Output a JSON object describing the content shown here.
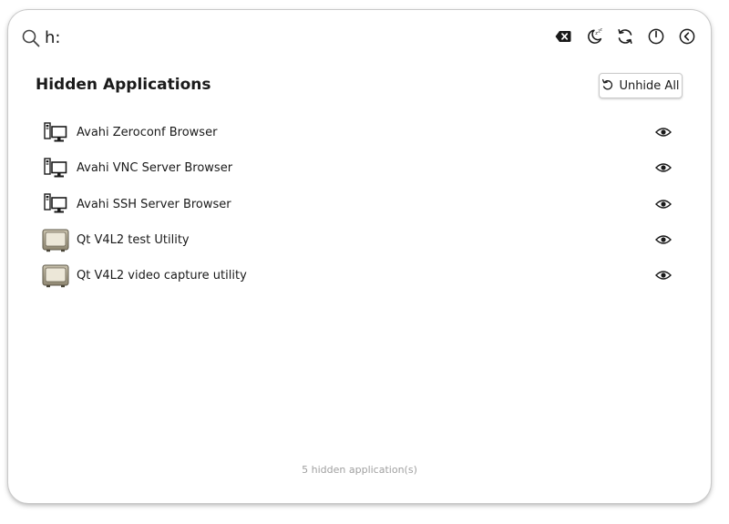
{
  "search": {
    "value": "h:",
    "icon": "search-icon"
  },
  "toolbar": {
    "buttons": [
      {
        "name": "clear-search",
        "icon": "backspace-icon"
      },
      {
        "name": "sleep",
        "icon": "sleep-moon-icon"
      },
      {
        "name": "refresh",
        "icon": "refresh-icon"
      },
      {
        "name": "power",
        "icon": "power-icon"
      },
      {
        "name": "back",
        "icon": "back-arrow-icon"
      }
    ]
  },
  "section": {
    "title": "Hidden Applications"
  },
  "unhide_all": {
    "label": "Unhide All",
    "icon": "undo-icon"
  },
  "apps": [
    {
      "name": "Avahi Zeroconf Browser",
      "icon": "network-computer-icon"
    },
    {
      "name": "Avahi VNC Server Browser",
      "icon": "network-computer-icon"
    },
    {
      "name": "Avahi SSH Server Browser",
      "icon": "network-computer-icon"
    },
    {
      "name": "Qt V4L2 test Utility",
      "icon": "tv-monitor-icon"
    },
    {
      "name": "Qt V4L2 video capture utility",
      "icon": "tv-monitor-icon"
    }
  ],
  "footer": {
    "count_text": "5 hidden application(s)"
  },
  "colors": {
    "text": "#1a1a1a",
    "muted": "#a0a0a0",
    "border": "#c9c9c9"
  }
}
